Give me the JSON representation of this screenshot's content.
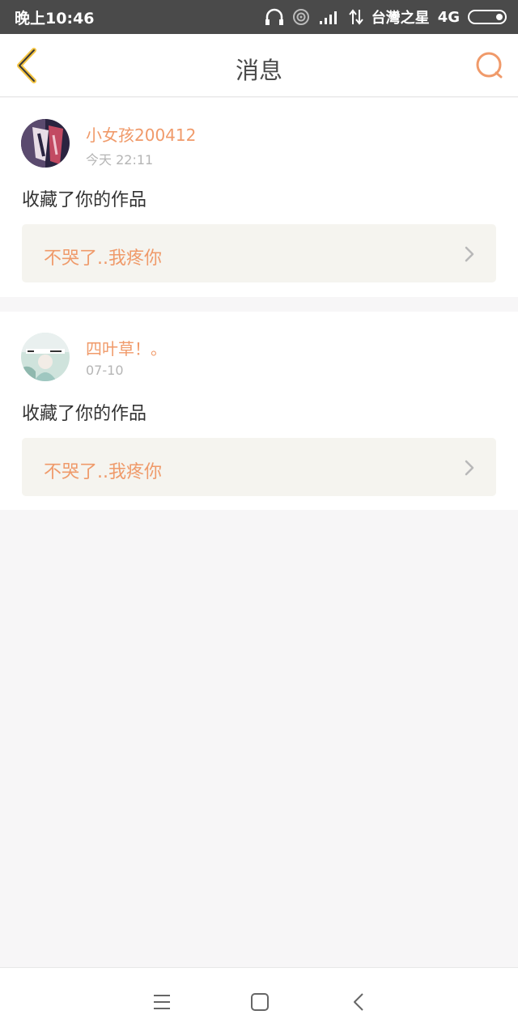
{
  "status_bar": {
    "time": "晚上10:46",
    "carrier": "台灣之星",
    "network": "4G"
  },
  "header": {
    "title": "消息"
  },
  "messages": [
    {
      "username": "小女孩200412",
      "time": "今天 22:11",
      "action": "收藏了你的作品",
      "work_title": "不哭了..我疼你"
    },
    {
      "username": "四叶草！。",
      "time": "07-10",
      "action": "收藏了你的作品",
      "work_title": "不哭了..我疼你"
    }
  ],
  "colors": {
    "accent": "#f09a6a",
    "back_arrow": "#f5c542",
    "status_bar": "#4a4a4a"
  },
  "icons": {
    "back": "chevron-left-icon",
    "search": "search-icon",
    "nav_menu": "menu-icon",
    "nav_home": "home-square-icon",
    "nav_back": "back-triangle-icon"
  }
}
